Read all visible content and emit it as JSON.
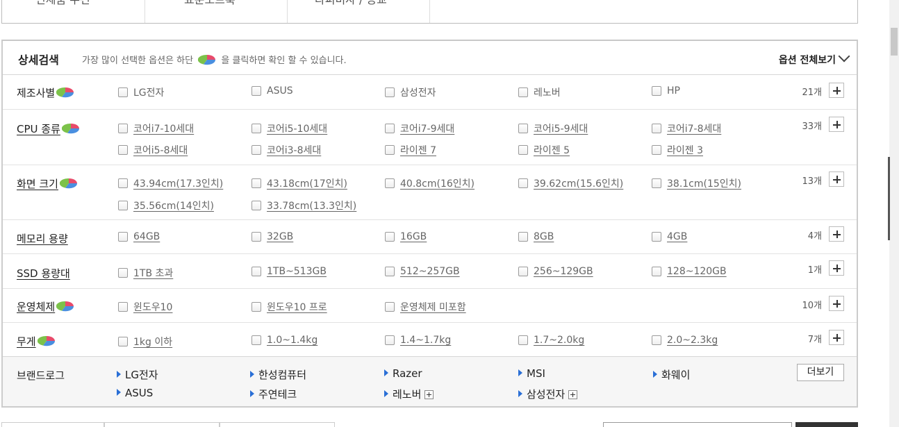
{
  "top_tabs": [
    "인체품 우선",
    "표준소트룩",
    "다피비자 / 등교"
  ],
  "header": {
    "title": "상세검색",
    "desc_before": "가장 많이 선택한 옵션은 하단",
    "desc_after": "을 클릭하면 확인 할 수 있습니다.",
    "show_all": "옵션 전체보기"
  },
  "rows": {
    "maker": {
      "label": "제조사별",
      "count": "21개",
      "options": [
        "LG전자",
        "ASUS",
        "삼성전자",
        "레노버",
        "HP"
      ]
    },
    "cpu": {
      "label": "CPU 종류",
      "count": "33개",
      "options": [
        "코어i7-10세대",
        "코어i5-10세대",
        "코어i7-9세대",
        "코어i5-9세대",
        "코어i7-8세대",
        "코어i5-8세대",
        "코어i3-8세대",
        "라이젠 7",
        "라이젠 5",
        "라이젠 3"
      ]
    },
    "screen": {
      "label": "화면 크기",
      "count": "13개",
      "options": [
        "43.94cm(17.3인치)",
        "43.18cm(17인치)",
        "40.8cm(16인치)",
        "39.62cm(15.6인치)",
        "38.1cm(15인치)",
        "35.56cm(14인치)",
        "33.78cm(13.3인치)"
      ]
    },
    "memory": {
      "label": "메모리 용량",
      "count": "4개",
      "options": [
        "64GB",
        "32GB",
        "16GB",
        "8GB",
        "4GB"
      ]
    },
    "ssd": {
      "label": "SSD 용량대",
      "count": "1개",
      "options": [
        "1TB 초과",
        "1TB~513GB",
        "512~257GB",
        "256~129GB",
        "128~120GB"
      ]
    },
    "os": {
      "label": "운영체제",
      "count": "10개",
      "options": [
        "윈도우10",
        "윈도우10 프로",
        "운영체제 미포함"
      ]
    },
    "weight": {
      "label": "무게",
      "count": "7개",
      "options": [
        "1kg 이하",
        "1.0~1.4kg",
        "1.4~1.7kg",
        "1.7~2.0kg",
        "2.0~2.3kg"
      ]
    }
  },
  "brand_logo": {
    "label": "브랜드로그",
    "brands": [
      "LG전자",
      "한성컴퓨터",
      "Razer",
      "MSI",
      "화웨이",
      "ASUS",
      "주연테크",
      "레노버",
      "삼성전자"
    ],
    "more": "더보기"
  },
  "colors": {
    "border": "#cccccc",
    "brand_arrow": "#2a6fd6",
    "brand_bg": "#f6f6f6"
  },
  "icons": {
    "pie": "pie-chart-icon",
    "plus": "plus-icon",
    "chevron": "chevron-down-icon"
  }
}
